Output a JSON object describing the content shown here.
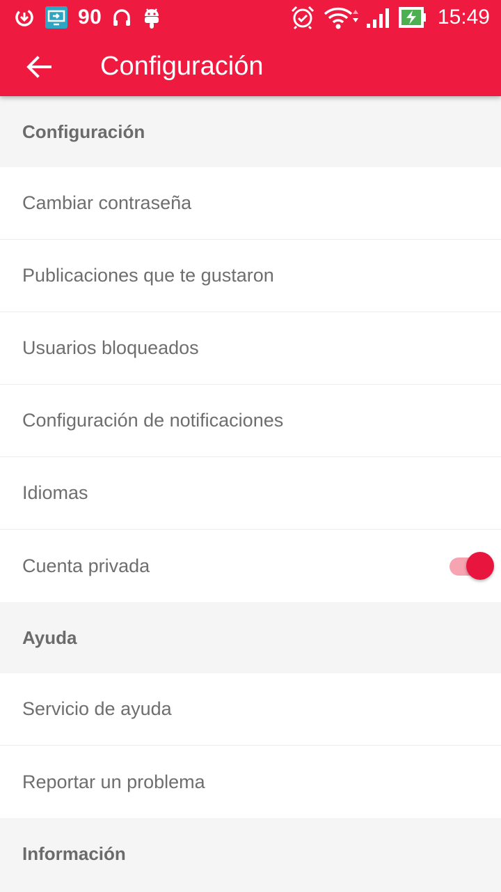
{
  "status_bar": {
    "signal_number": "90",
    "time": "15:49",
    "left_icons": [
      "download-icon",
      "screen-cast-icon",
      "headphones-icon",
      "android-icon"
    ],
    "right_icons": [
      "alarm-icon",
      "wifi-icon",
      "cell-signal-icon",
      "battery-charging-icon"
    ]
  },
  "toolbar": {
    "title": "Configuración",
    "back_icon": "arrow-left-icon"
  },
  "sections": {
    "config": {
      "header": "Configuración",
      "items": [
        "Cambiar contraseña",
        "Publicaciones que te gustaron",
        "Usuarios bloqueados",
        "Configuración de notificaciones",
        "Idiomas",
        "Cuenta privada"
      ],
      "private_account_toggle_on": true
    },
    "help": {
      "header": "Ayuda",
      "items": [
        "Servicio de ayuda",
        "Reportar un problema"
      ]
    },
    "info": {
      "header": "Información"
    }
  },
  "colors": {
    "accent": "#ee1a3f",
    "toggle_thumb": "#e8153e",
    "toggle_track": "#f6a3b2",
    "section_bg": "#f5f5f5",
    "row_text": "#6e6e6e",
    "header_text": "#6b6b6b"
  }
}
